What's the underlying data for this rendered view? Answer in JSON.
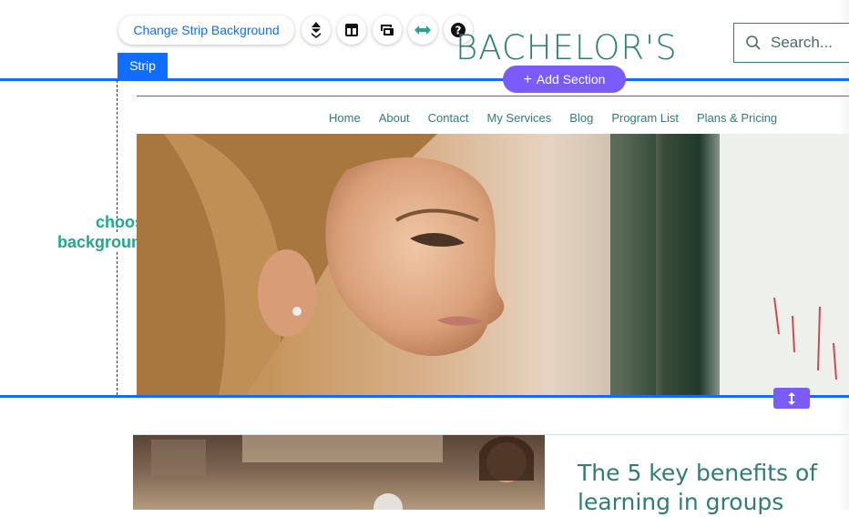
{
  "toolbar": {
    "change_bg_label": "Change Strip Background",
    "strip_tag": "Strip",
    "tools": [
      "layers-icon",
      "layout-icon",
      "animation-icon",
      "stretch-icon",
      "help-icon"
    ],
    "help_glyph": "?"
  },
  "header": {
    "site_title": "BACHELOR'S",
    "search_placeholder": "Search...",
    "add_section_label": "Add Section",
    "add_section_plus": "+"
  },
  "nav": {
    "items": [
      "Home",
      "About",
      "Contact",
      "My Services",
      "Blog",
      "Program List",
      "Plans & Pricing"
    ]
  },
  "annotation": {
    "line1": "choose",
    "line2": "background"
  },
  "content": {
    "article_title": "The 5 key benefits of learning in groups"
  },
  "colors": {
    "editor_blue": "#116dff",
    "section_purple": "#7a5cfa",
    "brand_teal": "#2f7d73",
    "annotation_green": "#1fa88a"
  }
}
